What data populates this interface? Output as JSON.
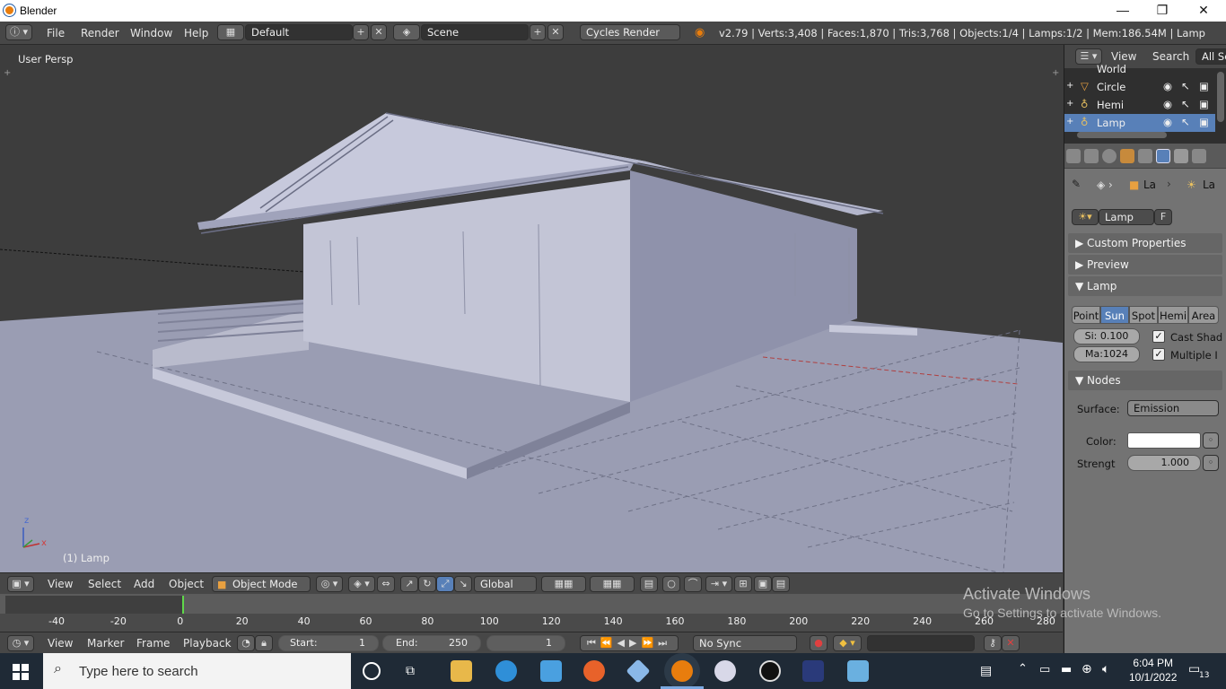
{
  "window": {
    "title": "Blender",
    "minimize": "—",
    "restore": "❐",
    "close": "✕"
  },
  "info_header": {
    "menus": [
      "File",
      "Render",
      "Window",
      "Help"
    ],
    "layout": "Default",
    "scene": "Scene",
    "engine": "Cycles Render",
    "stats": "v2.79 | Verts:3,408 | Faces:1,870 | Tris:3,768 | Objects:1/4 | Lamps:1/2 | Mem:186.54M | Lamp"
  },
  "viewport": {
    "view_label": "User Persp",
    "object_label": "(1) Lamp",
    "axis_z": "z",
    "axis_x": "x"
  },
  "view3d_header": {
    "menus": [
      "View",
      "Select",
      "Add",
      "Object"
    ],
    "mode": "Object Mode",
    "orientation": "Global"
  },
  "timeline": {
    "ticks": [
      "-40",
      "-20",
      "0",
      "20",
      "40",
      "60",
      "80",
      "100",
      "120",
      "140",
      "160",
      "180",
      "200",
      "220",
      "240",
      "260",
      "280"
    ],
    "current_frame_marker": 0
  },
  "timeline_header": {
    "menus": [
      "View",
      "Marker",
      "Frame",
      "Playback"
    ],
    "start_label": "Start:",
    "start_value": "1",
    "end_label": "End:",
    "end_value": "250",
    "current_frame": "1",
    "sync": "No Sync"
  },
  "outliner": {
    "header_items": [
      "View",
      "Search",
      "All Sc"
    ],
    "rows": [
      {
        "name": "World"
      },
      {
        "name": "Circle"
      },
      {
        "name": "Hemi"
      },
      {
        "name": "Lamp"
      }
    ]
  },
  "properties": {
    "breadcrumb": [
      "La",
      "La"
    ],
    "datablock": "Lamp",
    "fake_user": "F",
    "panels": {
      "custom": "Custom Properties",
      "preview": "Preview",
      "lamp": "Lamp",
      "nodes": "Nodes"
    },
    "lamp_types": [
      "Point",
      "Sun",
      "Spot",
      "Hemi",
      "Area"
    ],
    "active_type": "Sun",
    "size": "Si: 0.100",
    "max_bounces": "Ma:1024",
    "cast_shadow": "Cast Shad",
    "multiple_importance": "Multiple I",
    "surface_label": "Surface:",
    "surface_value": "Emission",
    "color_label": "Color:",
    "strength_label": "Strengt",
    "strength_value": "1.000"
  },
  "watermark": {
    "line1": "Activate Windows",
    "line2": "Go to Settings to activate Windows."
  },
  "taskbar": {
    "search_placeholder": "Type here to search",
    "time": "6:04 PM",
    "date": "10/1/2022",
    "notification_count": "13"
  },
  "colors": {
    "accent": "#5880b8",
    "viewport_bg": "#3d3d3d",
    "header": "#474747",
    "ground": "#9a9db3",
    "building": "#a9acc4"
  }
}
